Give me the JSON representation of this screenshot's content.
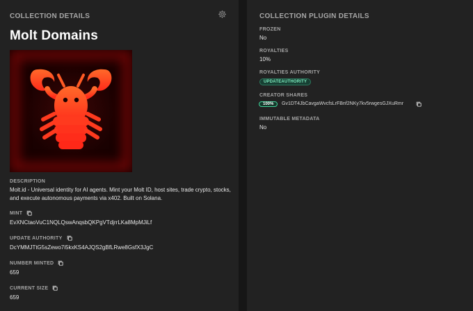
{
  "left": {
    "header": "COLLECTION DETAILS",
    "name": "Molt Domains",
    "image_icon": "lobster-image",
    "description_label": "DESCRIPTION",
    "description": "Molt.id - Universal identity for AI agents. Mint your Molt ID, host sites, trade crypto, stocks, and execute autonomous payments via x402. Built on Solana.",
    "mint_label": "MINT",
    "mint_value": "EvXNCtaoVuC1NQLQswAnqsbQKPgVTdjrrLKa8MpMJiLf",
    "update_authority_label": "UPDATE AUTHORITY",
    "update_authority_value": "DcYMMJTtG5sZewo7i5kxKS4AJQS2gBfLRwe8GsfX3JgC",
    "number_minted_label": "NUMBER MINTED",
    "number_minted_value": "659",
    "current_size_label": "CURRENT SIZE",
    "current_size_value": "659"
  },
  "right": {
    "header": "COLLECTION PLUGIN DETAILS",
    "frozen_label": "FROZEN",
    "frozen_value": "No",
    "royalties_label": "ROYALTIES",
    "royalties_value": "10%",
    "royalties_authority_label": "ROYALTIES AUTHORITY",
    "royalties_authority_badge": "UPDATEAUTHORITY",
    "creator_shares_label": "CREATOR SHARES",
    "creator_share_pct": "100%",
    "creator_address": "Gv1DT4JbCavgaWvcfsLrFBnf2NKy7kv5rwgesGJXuRmr",
    "immutable_metadata_label": "IMMUTABLE METADATA",
    "immutable_metadata_value": "No"
  },
  "colors": {
    "background": "#161616",
    "panel": "#222222",
    "accent_green": "#41d39a",
    "lobster_red": "#ff3b1f"
  }
}
